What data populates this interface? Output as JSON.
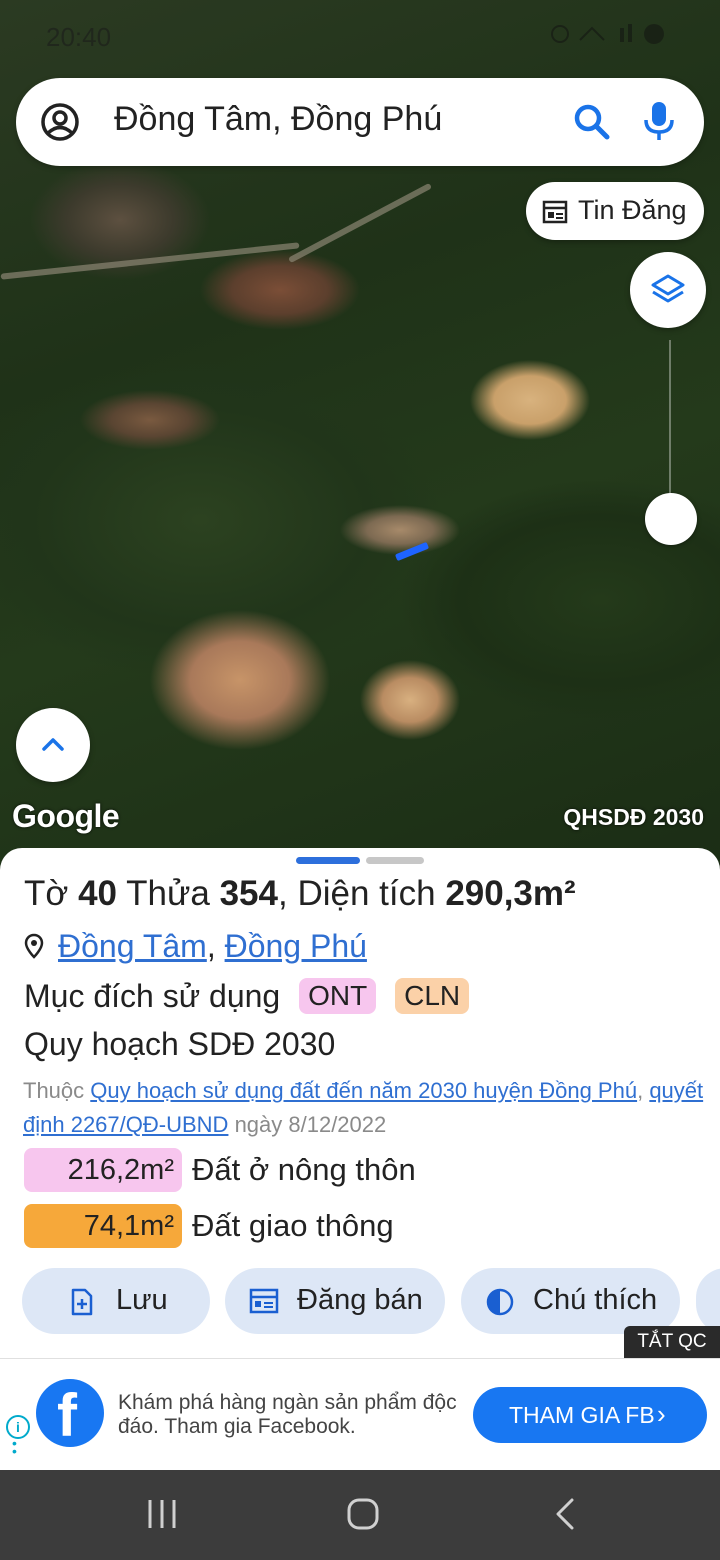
{
  "status_bar": {
    "time": "20:40"
  },
  "search": {
    "value": "Đồng Tâm, Đồng Phú"
  },
  "map": {
    "tin_dang_label": "Tin Đăng",
    "google_label": "Google",
    "layer_label": "QHSDĐ 2030"
  },
  "parcel": {
    "to_label": "Tờ",
    "to_value": "40",
    "thua_label": "Thửa",
    "thua_value": "354",
    "area_label": "Diện tích",
    "area_value": "290,3m²",
    "commune": "Đồng Tâm",
    "district": "Đồng Phú",
    "use_label": "Mục đích sử dụng",
    "use_codes": [
      "ONT",
      "CLN"
    ],
    "plan_title": "Quy hoạch SDĐ 2030",
    "belongs_prefix": "Thuộc",
    "plan_link": "Quy hoạch sử dụng đất đến năm 2030 huyện Đồng Phú",
    "decision_link": "quyết định 2267/QĐ-UBND",
    "decision_date": "ngày 8/12/2022",
    "areas": [
      {
        "value": "216,2m²",
        "label": "Đất ở nông thôn",
        "color": "#f7c6ee"
      },
      {
        "value": "74,1m²",
        "label": "Đất giao thông",
        "color": "#f6a83a"
      }
    ]
  },
  "actions": {
    "save": "Lưu",
    "post_sale": "Đăng bán",
    "legend": "Chú thích"
  },
  "ad": {
    "close_label": "TẮT QC",
    "text": "Khám phá hàng ngàn sản phẩm độc đáo. Tham gia Facebook.",
    "button": "THAM GIA FB",
    "brand_color": "#1877f2"
  }
}
